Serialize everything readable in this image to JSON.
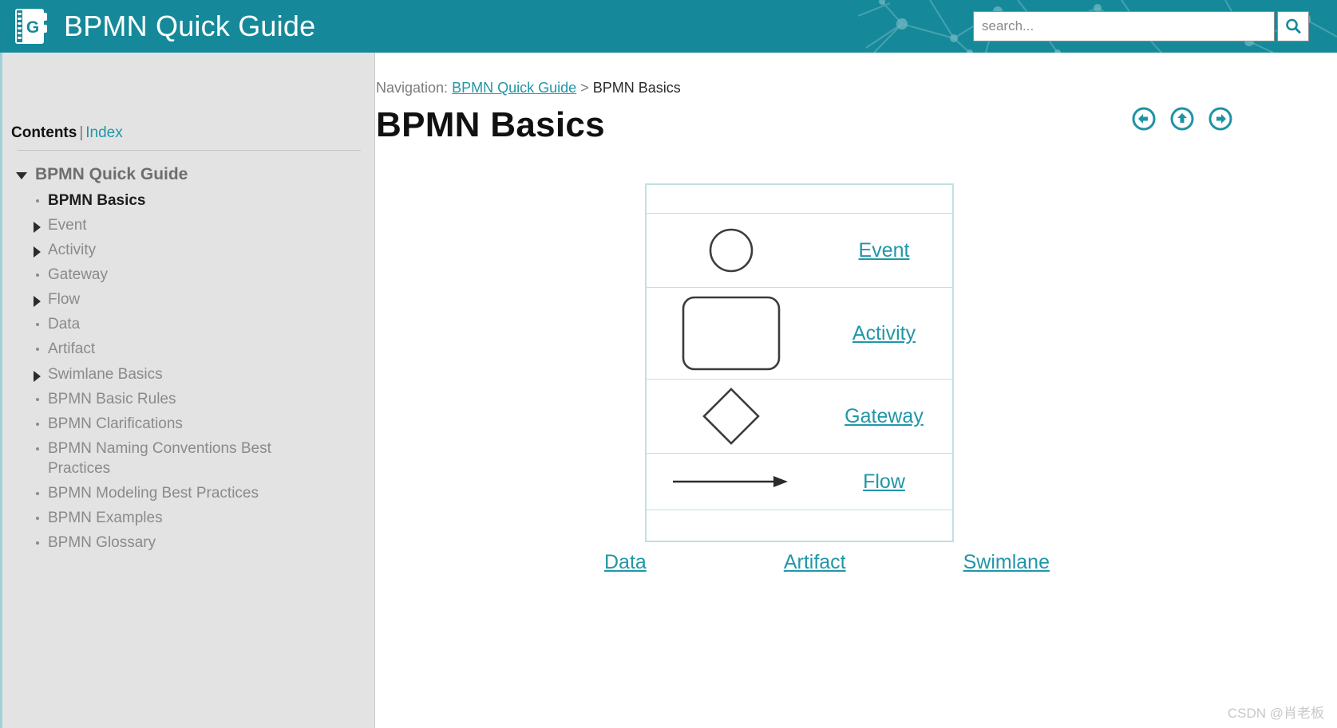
{
  "header": {
    "title": "BPMN Quick Guide",
    "logo_icon": "notebook-g-icon",
    "logo_letter": "G",
    "search_placeholder": "search...",
    "search_value": "",
    "search_icon": "search-icon",
    "background_color": "#15899a"
  },
  "sidebar": {
    "contents_label": "Contents",
    "separator": "|",
    "index_label": "Index",
    "root": {
      "label": "BPMN Quick Guide",
      "expanded": true,
      "marker": "triangle-down"
    },
    "items": [
      {
        "label": "BPMN Basics",
        "marker": "dot",
        "current": true
      },
      {
        "label": "Event",
        "marker": "triangle-right",
        "current": false
      },
      {
        "label": "Activity",
        "marker": "triangle-right",
        "current": false
      },
      {
        "label": "Gateway",
        "marker": "dot",
        "current": false
      },
      {
        "label": "Flow",
        "marker": "triangle-right",
        "current": false
      },
      {
        "label": "Data",
        "marker": "dot",
        "current": false
      },
      {
        "label": "Artifact",
        "marker": "dot",
        "current": false
      },
      {
        "label": "Swimlane Basics",
        "marker": "triangle-right",
        "current": false
      },
      {
        "label": "BPMN Basic Rules",
        "marker": "dot",
        "current": false
      },
      {
        "label": "BPMN Clarifications",
        "marker": "dot",
        "current": false
      },
      {
        "label": "BPMN Naming Conventions Best Practices",
        "marker": "dot",
        "current": false
      },
      {
        "label": "BPMN Modeling Best Practices",
        "marker": "dot",
        "current": false
      },
      {
        "label": "BPMN Examples",
        "marker": "dot",
        "current": false
      },
      {
        "label": "BPMN Glossary",
        "marker": "dot",
        "current": false
      }
    ]
  },
  "main": {
    "breadcrumb": {
      "prefix": "Navigation:",
      "link": "BPMN Quick Guide",
      "separator": ">",
      "current": "BPMN Basics"
    },
    "page_title": "BPMN Basics",
    "nav_buttons": [
      {
        "name": "back-button",
        "icon": "circle-arrow-left-icon"
      },
      {
        "name": "up-button",
        "icon": "circle-arrow-up-icon"
      },
      {
        "name": "forward-button",
        "icon": "circle-arrow-right-icon"
      }
    ],
    "diagram_table": {
      "rows": [
        {
          "shape": "none",
          "label": ""
        },
        {
          "shape": "circle",
          "label": "Event"
        },
        {
          "shape": "rounded-rectangle",
          "label": "Activity"
        },
        {
          "shape": "diamond",
          "label": "Gateway"
        },
        {
          "shape": "arrow",
          "label": "Flow"
        },
        {
          "shape": "none",
          "label": ""
        }
      ],
      "border_color": "#bfe0e4",
      "shape_stroke": "#3c3c3c"
    },
    "bottom_links": [
      {
        "label": "Data"
      },
      {
        "label": "Artifact"
      },
      {
        "label": "Swimlane"
      }
    ]
  },
  "watermark": {
    "text": "CSDN @肖老板"
  },
  "colors": {
    "brand_teal": "#15899a",
    "link_teal": "#2196a8",
    "table_border": "#bfe0e4",
    "sidebar_bg": "#e3e3e3"
  }
}
